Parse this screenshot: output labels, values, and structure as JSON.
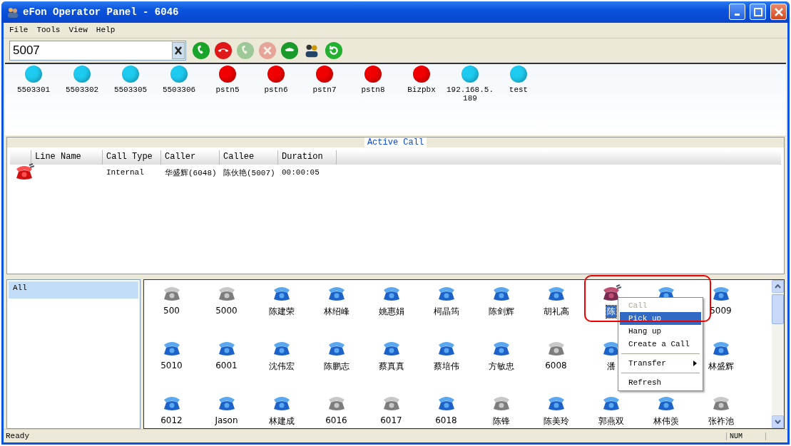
{
  "window": {
    "title": "eFon Operator Panel - 6046"
  },
  "menu": [
    "File",
    "Tools",
    "View",
    "Help"
  ],
  "toolbar": {
    "dial_value": "5007",
    "buttons": [
      {
        "kind": "call",
        "disabled": false
      },
      {
        "kind": "hangup",
        "disabled": false
      },
      {
        "kind": "pickup",
        "disabled": true
      },
      {
        "kind": "cancel",
        "disabled": true
      },
      {
        "kind": "transfer",
        "disabled": false
      },
      {
        "kind": "contacts",
        "disabled": false
      },
      {
        "kind": "refresh",
        "disabled": false
      }
    ]
  },
  "trunks": [
    {
      "label": "5503301",
      "color": "#1ecbf0"
    },
    {
      "label": "5503302",
      "color": "#1ecbf0"
    },
    {
      "label": "5503305",
      "color": "#1ecbf0"
    },
    {
      "label": "5503306",
      "color": "#1ecbf0"
    },
    {
      "label": "pstn5",
      "color": "#f00000"
    },
    {
      "label": "pstn6",
      "color": "#f00000"
    },
    {
      "label": "pstn7",
      "color": "#f00000"
    },
    {
      "label": "pstn8",
      "color": "#f00000"
    },
    {
      "label": "Bizpbx",
      "color": "#f00000"
    },
    {
      "label": "192.168.5.189",
      "color": "#1ecbf0"
    },
    {
      "label": "test",
      "color": "#1ecbf0"
    }
  ],
  "active_call": {
    "title": "Active Call",
    "columns": [
      "Line Name",
      "Call Type",
      "Caller",
      "Callee",
      "Duration"
    ],
    "rows": [
      {
        "kind": "ringing",
        "cells": [
          "",
          "Internal",
          "华盛辉(6048)",
          "陈伙艳(5007)",
          "00:00:05"
        ]
      }
    ]
  },
  "groups": [
    {
      "label": "All",
      "selected": true
    }
  ],
  "extensions": [
    {
      "label": "500",
      "kind": "offline",
      "selected": false
    },
    {
      "label": "5000",
      "kind": "offline",
      "selected": false
    },
    {
      "label": "陈建荣",
      "kind": "idle",
      "selected": false
    },
    {
      "label": "林绍峰",
      "kind": "idle",
      "selected": false
    },
    {
      "label": "姚惠娟",
      "kind": "idle",
      "selected": false
    },
    {
      "label": "柯晶筠",
      "kind": "idle",
      "selected": false
    },
    {
      "label": "陈剑辉",
      "kind": "idle",
      "selected": false
    },
    {
      "label": "胡礼高",
      "kind": "idle",
      "selected": false
    },
    {
      "label": "陈",
      "kind": "ringing",
      "selected": true
    },
    {
      "kind": "idle"
    },
    {
      "label": "5009",
      "kind": "idle",
      "selected": false
    },
    {
      "label": "5010",
      "kind": "idle",
      "selected": false
    },
    {
      "label": "6001",
      "kind": "idle",
      "selected": false
    },
    {
      "label": "沈伟宏",
      "kind": "idle",
      "selected": false
    },
    {
      "label": "陈鹏志",
      "kind": "idle",
      "selected": false
    },
    {
      "label": "蔡真真",
      "kind": "idle",
      "selected": false
    },
    {
      "label": "蔡培伟",
      "kind": "idle",
      "selected": false
    },
    {
      "label": "方敏忠",
      "kind": "idle",
      "selected": false
    },
    {
      "label": "6008",
      "kind": "offline",
      "selected": false
    },
    {
      "label": "潘",
      "kind": "idle",
      "selected": false
    },
    {
      "kind": "hidden"
    },
    {
      "label": "林盛辉",
      "kind": "idle",
      "selected": false
    },
    {
      "label": "6012",
      "kind": "idle",
      "selected": false
    },
    {
      "label": "Jason",
      "kind": "idle",
      "selected": false
    },
    {
      "label": "林建成",
      "kind": "idle",
      "selected": false
    },
    {
      "label": "6016",
      "kind": "offline",
      "selected": false
    },
    {
      "label": "6017",
      "kind": "offline",
      "selected": false
    },
    {
      "label": "6018",
      "kind": "idle",
      "selected": false
    },
    {
      "label": "陈锋",
      "kind": "offline",
      "selected": false
    },
    {
      "label": "陈美玲",
      "kind": "idle",
      "selected": false
    },
    {
      "label": "郭燕双",
      "kind": "idle",
      "selected": false
    },
    {
      "label": "林伟羡",
      "kind": "idle",
      "selected": false
    },
    {
      "label": "张祚池",
      "kind": "offline",
      "selected": false
    }
  ],
  "context_menu": [
    {
      "kind": "item",
      "label": "Call",
      "disabled": true,
      "selected": false
    },
    {
      "kind": "item",
      "label": "Pick up",
      "disabled": false,
      "selected": true
    },
    {
      "kind": "item",
      "label": "Hang up",
      "disabled": false,
      "selected": false
    },
    {
      "kind": "item",
      "label": "Create a Call",
      "disabled": false,
      "selected": false
    },
    {
      "kind": "separator"
    },
    {
      "kind": "submenu",
      "label": "Transfer",
      "disabled": false,
      "selected": false
    },
    {
      "kind": "separator"
    },
    {
      "kind": "item",
      "label": "Refresh",
      "disabled": false,
      "selected": false
    }
  ],
  "status_bar": {
    "text": "Ready",
    "indicator": "NUM"
  }
}
